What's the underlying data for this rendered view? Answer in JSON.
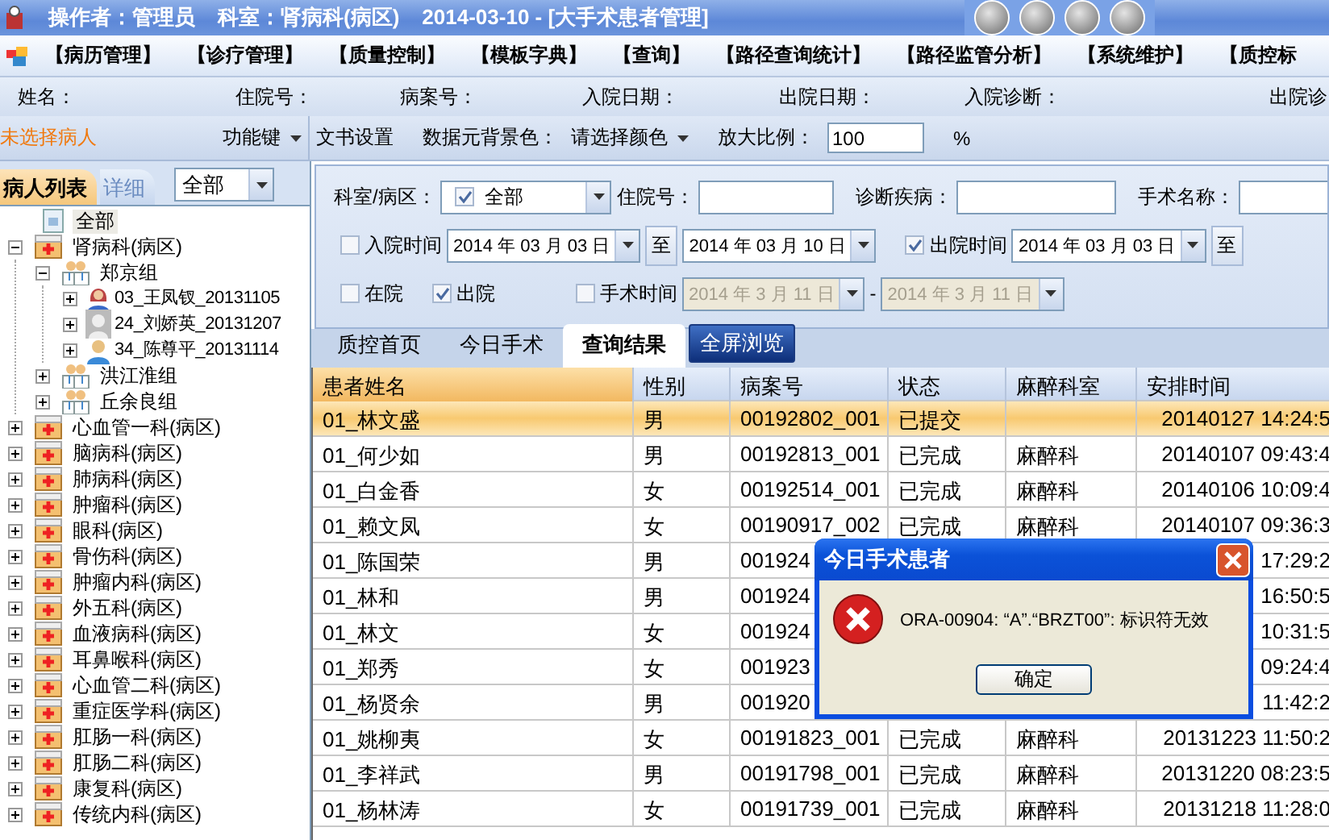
{
  "title_bar": {
    "operator": "操作者：管理员",
    "department": "科室：肾病科(病区)",
    "context": "2014-03-10 - [大手术患者管理]"
  },
  "menu": [
    "【病历管理】",
    "【诊疗管理】",
    "【质量控制】",
    "【模板字典】",
    "【查询】",
    "【路径查询统计】",
    "【路径监管分析】",
    "【系统维护】",
    "【质控标"
  ],
  "patient_info": [
    "姓名：",
    "住院号：",
    "病案号：",
    "入院日期：",
    "出院日期：",
    "入院诊断：",
    "出院诊"
  ],
  "toolbar": {
    "patient": "未选择病人",
    "function_key": "功能键",
    "doc_settings": "文书设置",
    "bg_color_label": "数据元背景色：",
    "bg_color": "请选择颜色",
    "zoom_label": "放大比例：",
    "zoom": "100",
    "zoom_unit": "%"
  },
  "left_panel": {
    "tabs": [
      {
        "label": "病人列表",
        "selected": true
      },
      {
        "label": "详细",
        "selected": false
      }
    ],
    "filter": "全部",
    "tree": [
      {
        "label": "全部",
        "kind": "root",
        "selected": true
      },
      {
        "label": "肾病科(病区)",
        "kind": "ward",
        "selected": false,
        "expanded": true,
        "children": [
          {
            "label": "郑京组",
            "kind": "group",
            "selected": false,
            "expanded": true,
            "children": [
              {
                "label": "03_王凤钗_20131105",
                "kind": "female",
                "selected": false,
                "expanded": false
              },
              {
                "label": "24_刘娇英_20131207",
                "kind": "inactive",
                "selected": false,
                "expanded": false
              },
              {
                "label": "34_陈尊平_20131114",
                "kind": "male",
                "selected": false,
                "expanded": false
              }
            ]
          },
          {
            "label": "洪江淮组",
            "kind": "group",
            "selected": false,
            "expanded": false
          },
          {
            "label": "丘余良组",
            "kind": "group",
            "selected": false,
            "expanded": false
          }
        ]
      },
      {
        "label": "心血管一科(病区)",
        "kind": "ward",
        "selected": false,
        "expanded": false
      },
      {
        "label": "脑病科(病区)",
        "kind": "ward",
        "selected": false,
        "expanded": false
      },
      {
        "label": "肺病科(病区)",
        "kind": "ward",
        "selected": false,
        "expanded": false
      },
      {
        "label": "肿瘤科(病区)",
        "kind": "ward",
        "selected": false,
        "expanded": false
      },
      {
        "label": "眼科(病区)",
        "kind": "ward",
        "selected": false,
        "expanded": false
      },
      {
        "label": "骨伤科(病区)",
        "kind": "ward",
        "selected": false,
        "expanded": false
      },
      {
        "label": "肿瘤内科(病区)",
        "kind": "ward",
        "selected": false,
        "expanded": false
      },
      {
        "label": "外五科(病区)",
        "kind": "ward",
        "selected": false,
        "expanded": false
      },
      {
        "label": "血液病科(病区)",
        "kind": "ward",
        "selected": false,
        "expanded": false
      },
      {
        "label": "耳鼻喉科(病区)",
        "kind": "ward",
        "selected": false,
        "expanded": false
      },
      {
        "label": "心血管二科(病区)",
        "kind": "ward",
        "selected": false,
        "expanded": false
      },
      {
        "label": "重症医学科(病区)",
        "kind": "ward",
        "selected": false,
        "expanded": false
      },
      {
        "label": "肛肠一科(病区)",
        "kind": "ward",
        "selected": false,
        "expanded": false
      },
      {
        "label": "肛肠二科(病区)",
        "kind": "ward",
        "selected": false,
        "expanded": false
      },
      {
        "label": "康复科(病区)",
        "kind": "ward",
        "selected": false,
        "expanded": false
      },
      {
        "label": "传统内科(病区)",
        "kind": "ward",
        "selected": false,
        "expanded": false
      }
    ]
  },
  "filters": {
    "ward_label": "科室/病区：",
    "ward": {
      "checked": true,
      "value": "全部"
    },
    "inpatient_no_label": "住院号：",
    "diagnosis_label": "诊断疾病：",
    "surgery_label": "手术名称：",
    "admit": {
      "label": "入院时间",
      "checked": false,
      "from": "2014 年 03 月 03 日",
      "to_label": "至",
      "to": "2014 年 03 月 10 日"
    },
    "discharge": {
      "label": "出院时间",
      "checked": true,
      "from": "2014 年 03 月 03 日",
      "to_label": "至"
    },
    "in_hospital": {
      "label": "在院",
      "checked": false
    },
    "discharged": {
      "label": "出院",
      "checked": true
    },
    "surgery_time": {
      "label": "手术时间",
      "checked": false,
      "from": "2014 年 3 月 11 日",
      "sep": "-",
      "to": "2014 年 3 月 11 日",
      "disabled": true
    }
  },
  "tabs": [
    {
      "label": "质控首页",
      "kind": "tab",
      "selected": false
    },
    {
      "label": "今日手术",
      "kind": "tab",
      "selected": false
    },
    {
      "label": "查询结果",
      "kind": "tab",
      "selected": true
    },
    {
      "label": "全屏浏览",
      "kind": "button",
      "selected": false
    }
  ],
  "table": {
    "columns": [
      "患者姓名",
      "性别",
      "病案号",
      "状态",
      "麻醉科室",
      "安排时间"
    ],
    "rows": [
      {
        "selected": true,
        "cells": [
          "01_林文盛",
          "男",
          "00192802_001",
          "已提交",
          "",
          "20140127 14:24:5"
        ]
      },
      {
        "selected": false,
        "cells": [
          "01_何少如",
          "男",
          "00192813_001",
          "已完成",
          "麻醉科",
          "20140107 09:43:4"
        ]
      },
      {
        "selected": false,
        "cells": [
          "01_白金香",
          "女",
          "00192514_001",
          "已完成",
          "麻醉科",
          "20140106 10:09:4"
        ]
      },
      {
        "selected": false,
        "cells": [
          "01_赖文凤",
          "女",
          "00190917_002",
          "已完成",
          "麻醉科",
          "20140107 09:36:3"
        ]
      },
      {
        "selected": false,
        "cells": [
          "01_陈国荣",
          "男",
          "001924",
          "",
          "",
          "17:29:2"
        ]
      },
      {
        "selected": false,
        "cells": [
          "01_林和",
          "男",
          "001924",
          "",
          "",
          "16:50:5"
        ]
      },
      {
        "selected": false,
        "cells": [
          "01_林文",
          "女",
          "001924",
          "",
          "",
          "10:31:5"
        ]
      },
      {
        "selected": false,
        "cells": [
          "01_郑秀",
          "女",
          "001923",
          "",
          "",
          "09:24:4"
        ]
      },
      {
        "selected": false,
        "cells": [
          "01_杨贤余",
          "男",
          "001920",
          "",
          "",
          "11:42:2"
        ]
      },
      {
        "selected": false,
        "cells": [
          "01_姚柳夷",
          "女",
          "00191823_001",
          "已完成",
          "麻醉科",
          "20131223 11:50:2"
        ]
      },
      {
        "selected": false,
        "cells": [
          "01_李祥武",
          "男",
          "00191798_001",
          "已完成",
          "麻醉科",
          "20131220 08:23:5"
        ]
      },
      {
        "selected": false,
        "cells": [
          "01_杨林涛",
          "女",
          "00191739_001",
          "已完成",
          "麻醉科",
          "20131218 11:28:0"
        ]
      }
    ]
  },
  "dialog": {
    "title": "今日手术患者",
    "message": "ORA-00904: “A”.“BRZT00”: 标识符无效",
    "button": "确定"
  }
}
